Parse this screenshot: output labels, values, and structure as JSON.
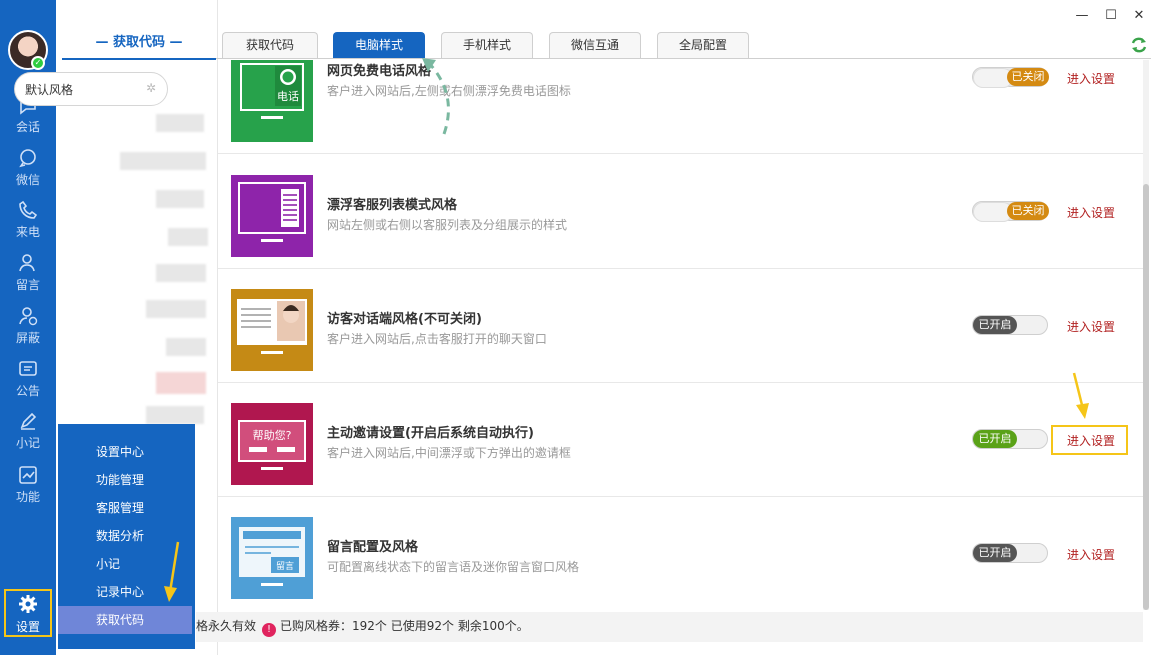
{
  "rail": {
    "items": [
      {
        "label": "会话",
        "icon": "chat-bubble-icon"
      },
      {
        "label": "微信",
        "icon": "wechat-icon"
      },
      {
        "label": "来电",
        "icon": "phone-icon"
      },
      {
        "label": "留言",
        "icon": "message-user-icon"
      },
      {
        "label": "屏蔽",
        "icon": "block-user-icon"
      },
      {
        "label": "公告",
        "icon": "announcement-icon"
      },
      {
        "label": "小记",
        "icon": "pen-icon"
      },
      {
        "label": "功能",
        "icon": "chart-icon"
      }
    ],
    "settings_label": "设置",
    "accent": "#1565c0",
    "highlight": "#f5c518"
  },
  "side": {
    "title": "— 获取代码 —",
    "search_value": "默认风格"
  },
  "flyout": {
    "items": [
      "设置中心",
      "功能管理",
      "客服管理",
      "数据分析",
      "小记",
      "记录中心",
      "获取代码"
    ],
    "active_index": 6
  },
  "tabs": [
    "获取代码",
    "电脑样式",
    "手机样式",
    "微信互通",
    "全局配置"
  ],
  "active_tab": 1,
  "styles": [
    {
      "title": "网页免费电话风格",
      "desc": "客户进入网站后,左侧或右侧漂浮免费电话图标",
      "state": "已关闭",
      "enter": "进入设置",
      "thumb_color": "#27a24b",
      "thumb_text": "电话"
    },
    {
      "title": "漂浮客服列表模式风格",
      "desc": "网站左侧或右侧以客服列表及分组展示的样式",
      "state": "已关闭",
      "enter": "进入设置",
      "thumb_color": "#8e24aa",
      "thumb_text": ""
    },
    {
      "title": "访客对话端风格(不可关闭)",
      "desc": "客户进入网站后,点击客服打开的聊天窗口",
      "state": "已开启",
      "enter": "进入设置",
      "thumb_color": "#c58a15",
      "thumb_text": ""
    },
    {
      "title": "主动邀请设置(开启后系统自动执行)",
      "desc": "客户进入网站后,中间漂浮或下方弹出的邀请框",
      "state": "已开启",
      "enter": "进入设置",
      "thumb_color": "#b0174f",
      "thumb_text": "帮助您?"
    },
    {
      "title": "留言配置及风格",
      "desc": "可配置离线状态下的留言语及迷你留言窗口风格",
      "state": "已开启",
      "enter": "进入设置",
      "thumb_color": "#4f9fd6",
      "thumb_text": "留言"
    }
  ],
  "footer": {
    "prefix": "格永久有效",
    "info_icon": "!",
    "text": "已购风格券：192个 已使用92个 剩余100个。"
  },
  "window": {
    "minimize": "—",
    "maximize": "☐",
    "close": "✕"
  }
}
